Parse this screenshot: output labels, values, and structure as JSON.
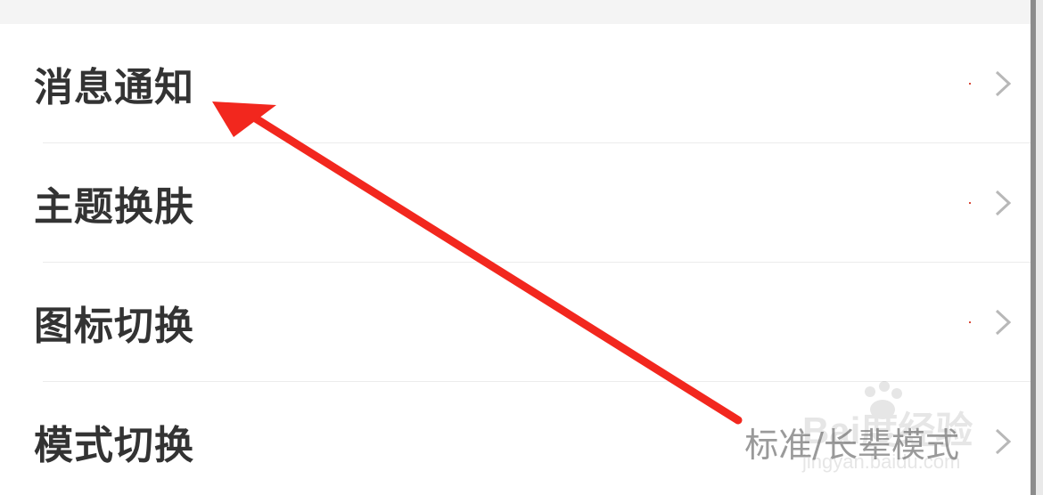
{
  "settings": {
    "items": [
      {
        "label": "消息通知",
        "value": ""
      },
      {
        "label": "主题换肤",
        "value": ""
      },
      {
        "label": "图标切换",
        "value": ""
      },
      {
        "label": "模式切换",
        "value": "标准/长辈模式"
      }
    ]
  },
  "annotation": {
    "arrow_color": "#f2271e",
    "arrow_target": "消息通知"
  },
  "watermark": {
    "brand": "Bai度经验",
    "url": "jingyan.baidu.com"
  },
  "icons": {
    "row_chevron": "chevron-right-icon"
  },
  "colors": {
    "label_text": "#333333",
    "value_text": "#9a9a9a",
    "chevron": "#b8b8b8",
    "divider": "#ececec",
    "background": "#ffffff"
  }
}
